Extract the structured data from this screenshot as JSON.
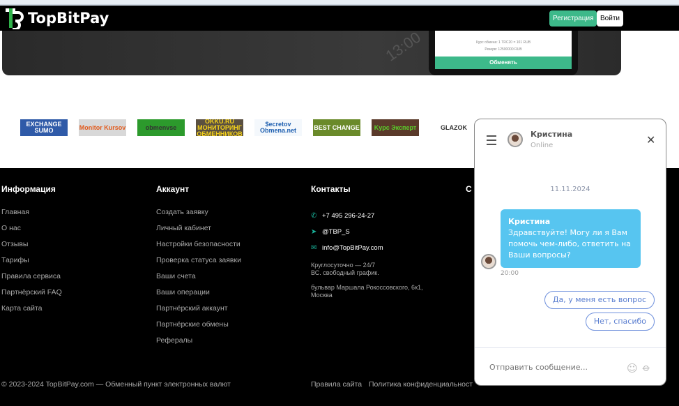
{
  "header": {
    "brand": "TopBitPay",
    "register": "Регистрация",
    "login": "Войти"
  },
  "hero": {
    "time_text": "13:00",
    "rate": "Курс обмена: 1 TRC20 = 101 RUB",
    "reserve": "Резерв: 12500000 RUB",
    "exchange_button": "Обменять"
  },
  "partners": [
    {
      "label": "EXCHANGE SUMO",
      "bg": "#2f5aa8",
      "fg": "#fff"
    },
    {
      "label": "Monitor Kursov",
      "bg": "#d8d8d8",
      "fg": "#e25a1c"
    },
    {
      "label": "obmenvse",
      "bg": "#2c9a2c",
      "fg": "#333"
    },
    {
      "label": "OKKU.RU МОНИТОРИНГ ОБМЕННИКОВ",
      "bg": "#5a5040",
      "fg": "#f5d21a"
    },
    {
      "label": "$ecretov Obmena.net",
      "bg": "#f4f8fc",
      "fg": "#1e5fb0"
    },
    {
      "label": "BEST CHANGE",
      "bg": "#6a8a2a",
      "fg": "#fff"
    },
    {
      "label": "Kypc Эксперт",
      "bg": "#5a3a2a",
      "fg": "#5ad02a"
    },
    {
      "label": "GLAZOK",
      "bg": "#fff",
      "fg": "#333"
    }
  ],
  "footer": {
    "info": {
      "title": "Информация",
      "links": [
        "Главная",
        "О нас",
        "Отзывы",
        "Тарифы",
        "Правила сервиса",
        "Партнёрский FAQ",
        "Карта сайта"
      ]
    },
    "account": {
      "title": "Аккаунт",
      "links": [
        "Создать заявку",
        "Личный кабинет",
        "Настройки безопасности",
        "Проверка статуса заявки",
        "Ваши счета",
        "Ваши операции",
        "Партнёрский аккаунт",
        "Партнёрские обмены",
        "Рефералы"
      ]
    },
    "contacts": {
      "title": "Контакты",
      "phone": "+7 495 296-24-27",
      "telegram": "@TBP_S",
      "email": "info@TopBitPay.com",
      "hours1": "Круглосуточно — 24/7",
      "hours2": "ВС. свободный график.",
      "address1": "бульвар Маршала Рокоссовского, 6к1,",
      "address2": "Москва"
    },
    "social_title": "С",
    "copyright": "© 2023-2024 TopBitPay.com — Обменный пункт электронных валют",
    "rules": "Правила сайта",
    "privacy": "Политика конфиденциальност"
  },
  "chat": {
    "agent": "Кристина",
    "status": "Online",
    "date": "11.11.2024",
    "message_author": "Кристина",
    "message": "Здравствуйте! Могу ли я Вам помочь чем-либо, ответить на Ваши вопросы?",
    "time": "20:00",
    "reply1": "Да, у меня есть вопрос",
    "reply2": "Нет, спасибо",
    "placeholder": "Отправить сообщение..."
  },
  "colors": {
    "accent": "#3db98a",
    "bubble": "#57c5f0",
    "reply_border": "#6d8fdc"
  }
}
